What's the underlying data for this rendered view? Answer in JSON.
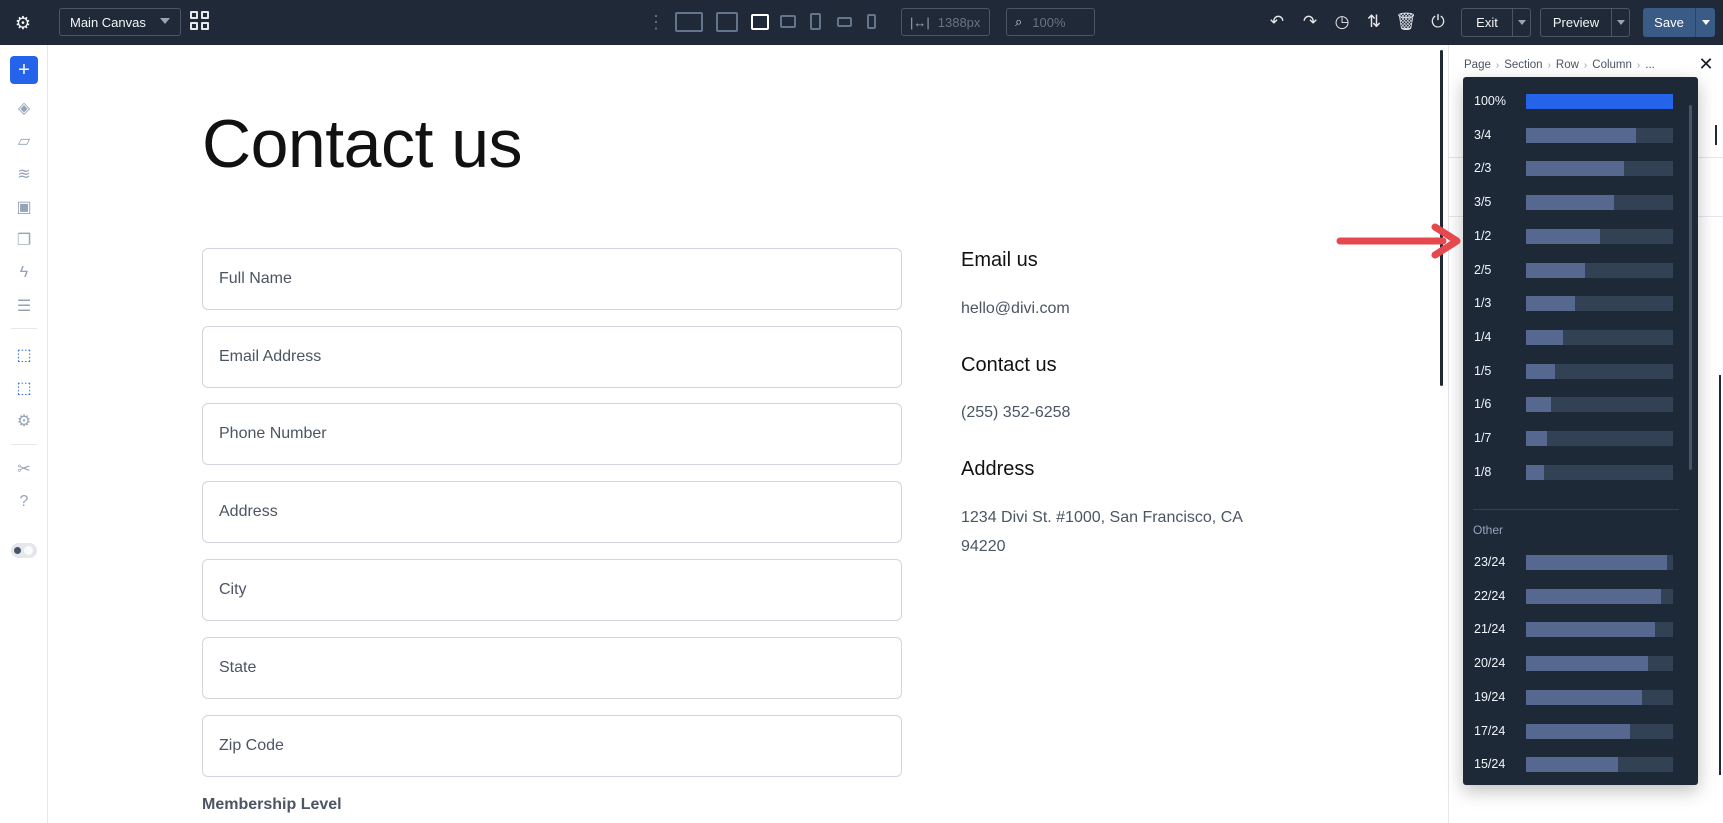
{
  "topbar": {
    "canvas_select": "Main Canvas",
    "width_value": "1388px",
    "zoom_value": "100%",
    "exit_label": "Exit",
    "preview_label": "Preview",
    "save_label": "Save"
  },
  "canvas": {
    "title": "Contact us",
    "fields": [
      "Full Name",
      "Email Address",
      "Phone Number",
      "Address",
      "City",
      "State",
      "Zip Code"
    ],
    "membership_label": "Membership Level",
    "info": {
      "email_heading": "Email us",
      "email_value": "hello@divi.com",
      "contact_heading": "Contact us",
      "contact_value": "(255) 352-6258",
      "address_heading": "Address",
      "address_value": "1234 Divi St. #1000, San Francisco, CA 94220"
    }
  },
  "panel": {
    "breadcrumb": [
      "Page",
      "Section",
      "Row",
      "Column",
      "..."
    ]
  },
  "width_dropdown": {
    "options": [
      {
        "label": "100%",
        "fraction": 1.0,
        "selected": true
      },
      {
        "label": "3/4",
        "fraction": 0.75
      },
      {
        "label": "2/3",
        "fraction": 0.6667
      },
      {
        "label": "3/5",
        "fraction": 0.6
      },
      {
        "label": "1/2",
        "fraction": 0.5
      },
      {
        "label": "2/5",
        "fraction": 0.4
      },
      {
        "label": "1/3",
        "fraction": 0.3333
      },
      {
        "label": "1/4",
        "fraction": 0.25
      },
      {
        "label": "1/5",
        "fraction": 0.2
      },
      {
        "label": "1/6",
        "fraction": 0.1667
      },
      {
        "label": "1/7",
        "fraction": 0.1429
      },
      {
        "label": "1/8",
        "fraction": 0.125
      }
    ],
    "other_label": "Other",
    "other_options": [
      {
        "label": "23/24",
        "fraction": 0.9583
      },
      {
        "label": "22/24",
        "fraction": 0.9167
      },
      {
        "label": "21/24",
        "fraction": 0.875
      },
      {
        "label": "20/24",
        "fraction": 0.8333
      },
      {
        "label": "19/24",
        "fraction": 0.7917
      },
      {
        "label": "17/24",
        "fraction": 0.7083
      },
      {
        "label": "15/24",
        "fraction": 0.625
      }
    ]
  },
  "colors": {
    "accent": "#2563eb",
    "annotation_arrow": "#e5484d"
  }
}
